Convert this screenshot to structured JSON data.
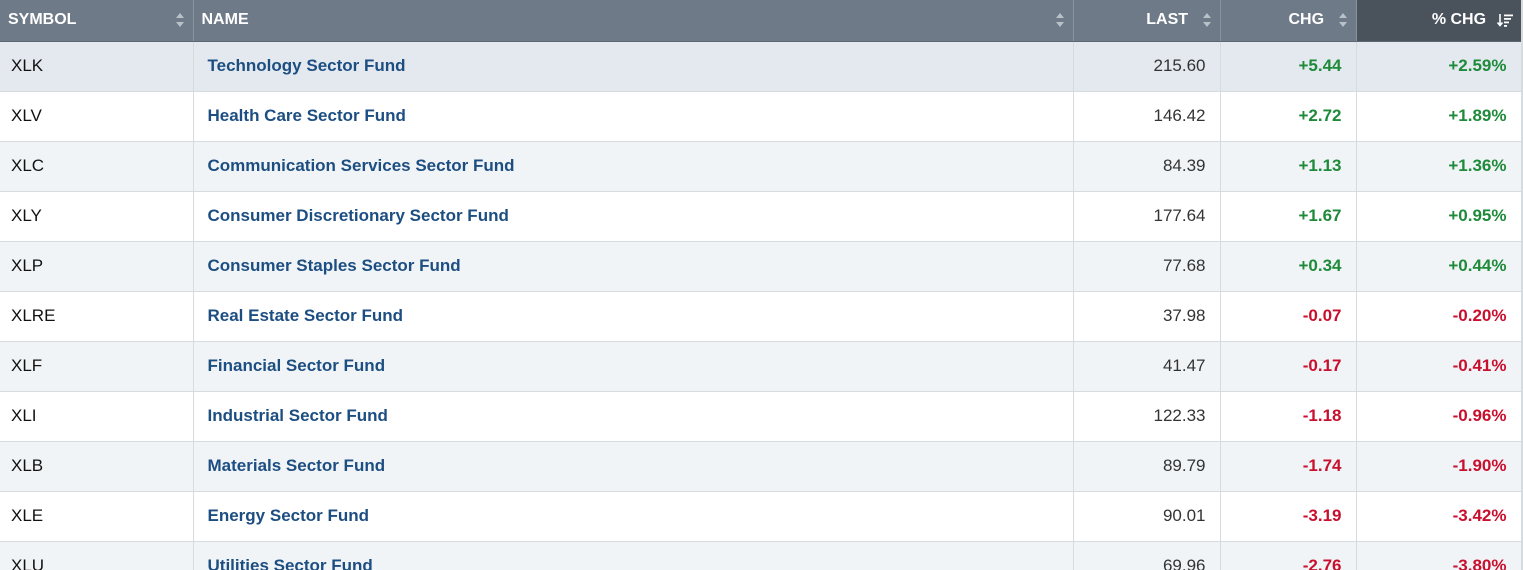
{
  "colors": {
    "header_bg": "#6e7a87",
    "header_sorted_bg": "#4a525c",
    "link": "#1d4e82",
    "positive": "#1e8a3a",
    "negative": "#c8102e"
  },
  "columns": [
    {
      "key": "symbol",
      "label": "SYMBOL",
      "icon": "sort-icon"
    },
    {
      "key": "name",
      "label": "NAME",
      "icon": "sort-icon"
    },
    {
      "key": "last",
      "label": "LAST",
      "icon": "sort-icon"
    },
    {
      "key": "chg",
      "label": "CHG",
      "icon": "sort-icon"
    },
    {
      "key": "pct_chg",
      "label": "% CHG",
      "icon": "sort-descending-icon"
    }
  ],
  "rows": [
    {
      "symbol": "XLK",
      "name": "Technology Sector Fund",
      "last": "215.60",
      "chg": "+5.44",
      "pct_chg": "+2.59%",
      "direction": "up"
    },
    {
      "symbol": "XLV",
      "name": "Health Care Sector Fund",
      "last": "146.42",
      "chg": "+2.72",
      "pct_chg": "+1.89%",
      "direction": "up"
    },
    {
      "symbol": "XLC",
      "name": "Communication Services Sector Fund",
      "last": "84.39",
      "chg": "+1.13",
      "pct_chg": "+1.36%",
      "direction": "up"
    },
    {
      "symbol": "XLY",
      "name": "Consumer Discretionary Sector Fund",
      "last": "177.64",
      "chg": "+1.67",
      "pct_chg": "+0.95%",
      "direction": "up"
    },
    {
      "symbol": "XLP",
      "name": "Consumer Staples Sector Fund",
      "last": "77.68",
      "chg": "+0.34",
      "pct_chg": "+0.44%",
      "direction": "up"
    },
    {
      "symbol": "XLRE",
      "name": "Real Estate Sector Fund",
      "last": "37.98",
      "chg": "-0.07",
      "pct_chg": "-0.20%",
      "direction": "down"
    },
    {
      "symbol": "XLF",
      "name": "Financial Sector Fund",
      "last": "41.47",
      "chg": "-0.17",
      "pct_chg": "-0.41%",
      "direction": "down"
    },
    {
      "symbol": "XLI",
      "name": "Industrial Sector Fund",
      "last": "122.33",
      "chg": "-1.18",
      "pct_chg": "-0.96%",
      "direction": "down"
    },
    {
      "symbol": "XLB",
      "name": "Materials Sector Fund",
      "last": "89.79",
      "chg": "-1.74",
      "pct_chg": "-1.90%",
      "direction": "down"
    },
    {
      "symbol": "XLE",
      "name": "Energy Sector Fund",
      "last": "90.01",
      "chg": "-3.19",
      "pct_chg": "-3.42%",
      "direction": "down"
    },
    {
      "symbol": "XLU",
      "name": "Utilities Sector Fund",
      "last": "69.96",
      "chg": "-2.76",
      "pct_chg": "-3.80%",
      "direction": "down"
    }
  ]
}
